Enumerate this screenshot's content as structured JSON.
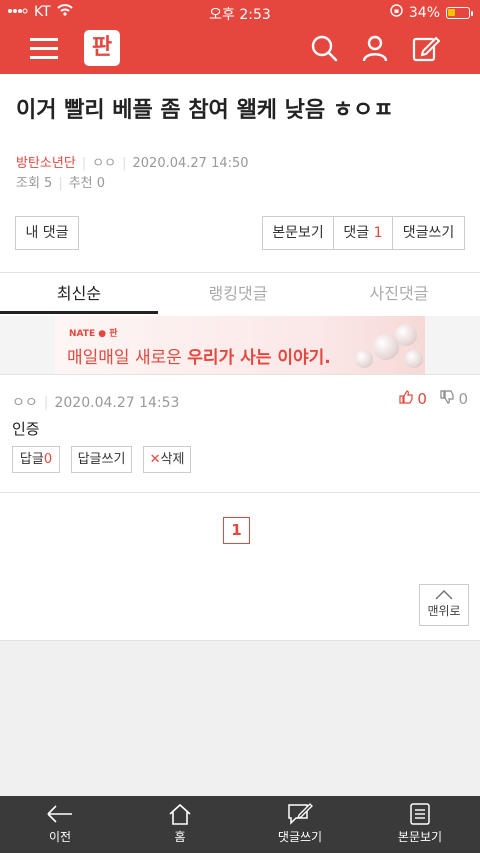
{
  "status_bar": {
    "carrier": "KT",
    "time": "오후 2:53",
    "battery": "34%",
    "battery_level": 0.34
  },
  "header": {
    "logo": "판"
  },
  "article": {
    "title": "이거 빨리 베플 좀 참여 왤케 낮음 ㅎㅇㅍ",
    "author": "방탄소년단",
    "nickname": "ㅇㅇ",
    "datetime": "2020.04.27 14:50",
    "views": "조회 5",
    "recommend": "추천 0"
  },
  "actions": {
    "my_comments": "내 댓글",
    "view_body": "본문보기",
    "comments_label": "댓글",
    "comments_count": "1",
    "write_comment": "댓글쓰기"
  },
  "tabs": [
    "최신순",
    "랭킹댓글",
    "사진댓글"
  ],
  "banner": {
    "brand": "NATE ● 판",
    "copy_normal": "매일매일 새로운 ",
    "copy_bold": "우리가 사는 이야기."
  },
  "comment": {
    "author": "ㅇㅇ",
    "datetime": "2020.04.27 14:53",
    "likes": "0",
    "dislikes": "0",
    "text": "인증",
    "reply_label": "답글",
    "reply_count": "0",
    "write_reply": "답글쓰기",
    "delete": "삭제"
  },
  "pagination": {
    "current": "1"
  },
  "to_top": "맨위로",
  "bottom_nav": [
    "이전",
    "홈",
    "댓글쓰기",
    "본문보기"
  ],
  "colors": {
    "brand_red": "#e5473f",
    "bottom_bar": "#3a3a3a"
  }
}
